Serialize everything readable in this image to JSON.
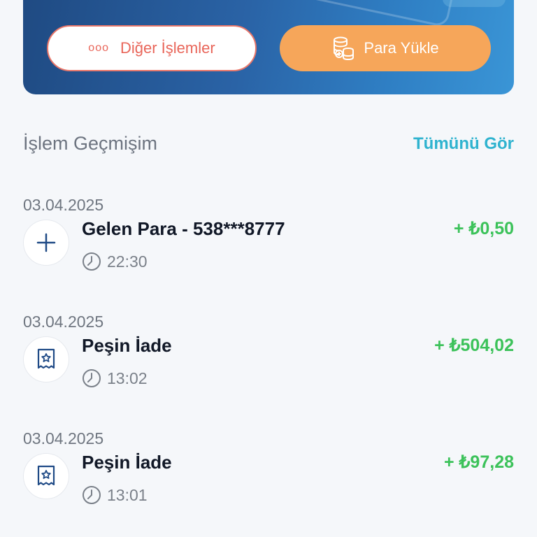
{
  "actions": {
    "other_label": "Diğer İşlemler",
    "other_dots": "ooo",
    "topup_label": "Para Yükle"
  },
  "history": {
    "title": "İşlem Geçmişim",
    "see_all": "Tümünü Gör"
  },
  "transactions": [
    {
      "date": "03.04.2025",
      "title": "Gelen Para - 538***8777",
      "time": "22:30",
      "amount": "+ ₺0,50",
      "icon": "plus-icon"
    },
    {
      "date": "03.04.2025",
      "title": "Peşin İade",
      "time": "13:02",
      "amount": "+ ₺504,02",
      "icon": "receipt-star-icon"
    },
    {
      "date": "03.04.2025",
      "title": "Peşin İade",
      "time": "13:01",
      "amount": "+ ₺97,28",
      "icon": "receipt-star-icon"
    }
  ],
  "colors": {
    "banner": "#2a63a6",
    "other_button_border": "#e9776a",
    "topup_button": "#f6a65a",
    "see_all": "#2fb3cf",
    "amount_positive": "#3cc25a"
  }
}
